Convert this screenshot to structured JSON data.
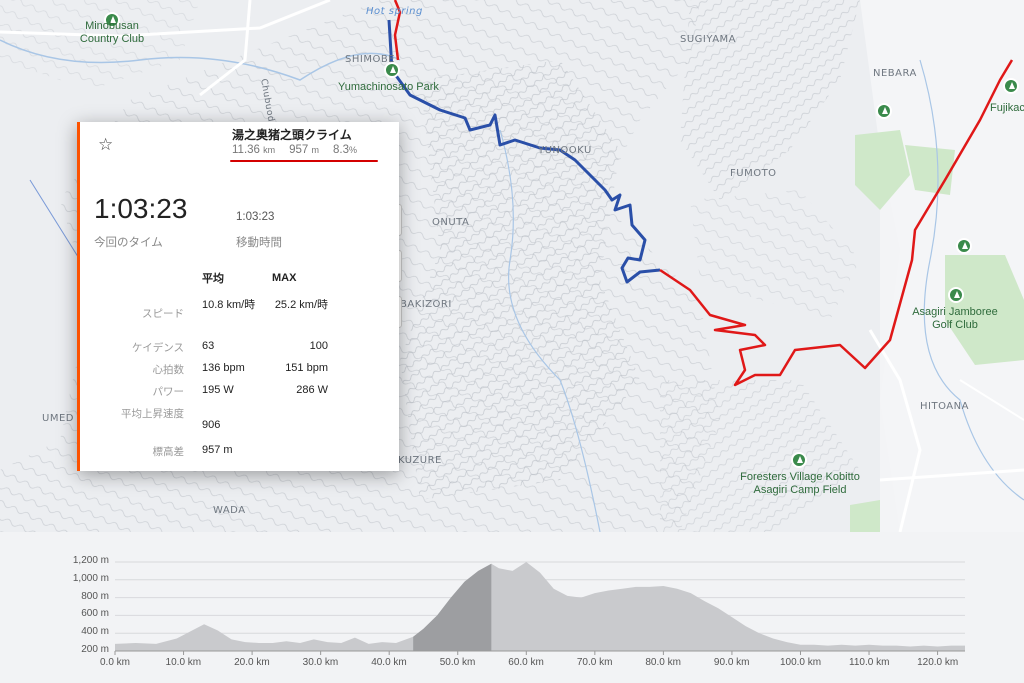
{
  "map": {
    "labels": {
      "hotspring": "Hot spring",
      "shimobe": "SHIMOBE",
      "sugiyama": "SUGIYAMA",
      "nebara": "NEBARA",
      "yunooku": "YUNOOKU",
      "fumoto": "FUMOTO",
      "onuta": "ONUTA",
      "bakizori": "BAKIZORI",
      "hitoana": "HITOANA",
      "umed": "UMED",
      "kuzure": "KUZURE",
      "wada": "WADA",
      "expwy": "Chubuodan Expwy"
    },
    "pois": {
      "minobusan": "Minobusan\nCountry Club",
      "yumachinosato": "Yumachinosato Park",
      "fujikachoen": "Fujikachoen",
      "asagiri_golf": "Asagiri Jamboree\nGolf Club",
      "foresters": "Foresters Village Kobitto\nAsagiri Camp Field"
    },
    "route_colors": {
      "segment": "#2a4fa8",
      "route": "#e01818"
    }
  },
  "card": {
    "title": "湯之奥猪之頭クライム",
    "distance": "11.36",
    "distance_unit": "km",
    "elev_gain": "957",
    "elev_gain_unit": "m",
    "grade": "8.3",
    "grade_unit": "%",
    "elapsed_time": "1:03:23",
    "elapsed_label": "今回のタイム",
    "moving_time": "1:03:23",
    "moving_label": "移動時間",
    "header_avg": "平均",
    "header_max": "MAX",
    "rows": [
      {
        "label": "スピード",
        "avg": "10.8 km/時",
        "max": "25.2 km/時"
      },
      {
        "label": "ケイデンス",
        "avg": "63",
        "max": "100"
      },
      {
        "label": "心拍数",
        "avg": "136 bpm",
        "max": "151 bpm"
      },
      {
        "label": "パワー",
        "avg": "195 W",
        "max": "286 W"
      },
      {
        "label": "平均上昇速度",
        "avg": "906",
        "max": ""
      },
      {
        "label": "標高差",
        "avg": "957 m",
        "max": ""
      }
    ],
    "accent_color": "#fc5200"
  },
  "chart_data": {
    "type": "area",
    "xlabel": "",
    "ylabel": "",
    "x_ticks": [
      "0.0 km",
      "10.0 km",
      "20.0 km",
      "30.0 km",
      "40.0 km",
      "50.0 km",
      "60.0 km",
      "70.0 km",
      "80.0 km",
      "90.0 km",
      "100.0 km",
      "110.0 km",
      "120.0 km"
    ],
    "y_ticks": [
      "1,200 m",
      "1,000 m",
      "800 m",
      "600 m",
      "400 m",
      "200 m"
    ],
    "xlim": [
      0,
      124
    ],
    "ylim": [
      200,
      1200
    ],
    "highlight_range_km": [
      43.5,
      54.9
    ],
    "series": [
      {
        "x": [
          0,
          3,
          6,
          9,
          11,
          13,
          15,
          17,
          19,
          21,
          23,
          25,
          27,
          29,
          31,
          33,
          35,
          37,
          39,
          41,
          43.5,
          45,
          47,
          49,
          51,
          53,
          54.9,
          56,
          58,
          60,
          62,
          64,
          66,
          68,
          70,
          72,
          74,
          76,
          78,
          80,
          82,
          84,
          86,
          88,
          90,
          92,
          94,
          96,
          98,
          100,
          102,
          104,
          106,
          108,
          110,
          112,
          114,
          116,
          118,
          120,
          122,
          124
        ],
        "y": [
          280,
          290,
          280,
          340,
          420,
          500,
          430,
          330,
          300,
          290,
          290,
          310,
          290,
          330,
          300,
          290,
          350,
          280,
          300,
          290,
          360,
          450,
          600,
          800,
          980,
          1100,
          1180,
          1130,
          1100,
          1200,
          1080,
          900,
          820,
          800,
          850,
          880,
          900,
          920,
          920,
          930,
          900,
          850,
          760,
          680,
          580,
          480,
          400,
          340,
          300,
          270,
          270,
          260,
          270,
          260,
          270,
          260,
          260,
          250,
          260,
          250,
          260,
          260
        ]
      }
    ]
  }
}
